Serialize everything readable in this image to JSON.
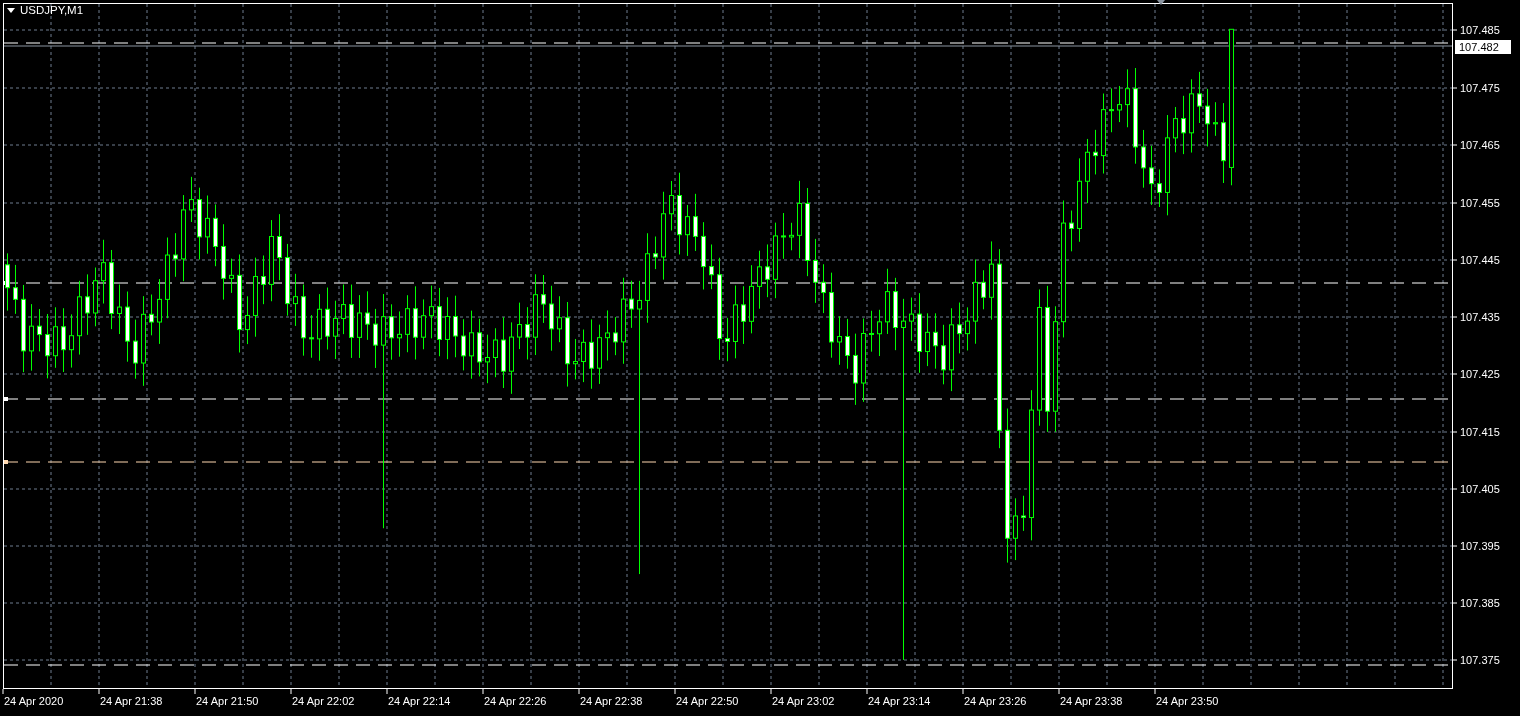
{
  "chart": {
    "title": "USDJPY,M1",
    "price_axis": [
      "107.485",
      "107.475",
      "107.465",
      "107.455",
      "107.445",
      "107.435",
      "107.425",
      "107.415",
      "107.405",
      "107.395",
      "107.385",
      "107.375"
    ],
    "current_price": "107.482",
    "time_axis": [
      "24 Apr 2020",
      "24 Apr 21:38",
      "24 Apr 21:50",
      "24 Apr 22:02",
      "24 Apr 22:14",
      "24 Apr 22:26",
      "24 Apr 22:38",
      "24 Apr 22:50",
      "24 Apr 23:02",
      "24 Apr 23:14",
      "24 Apr 23:26",
      "24 Apr 23:38",
      "24 Apr 23:50"
    ]
  }
}
